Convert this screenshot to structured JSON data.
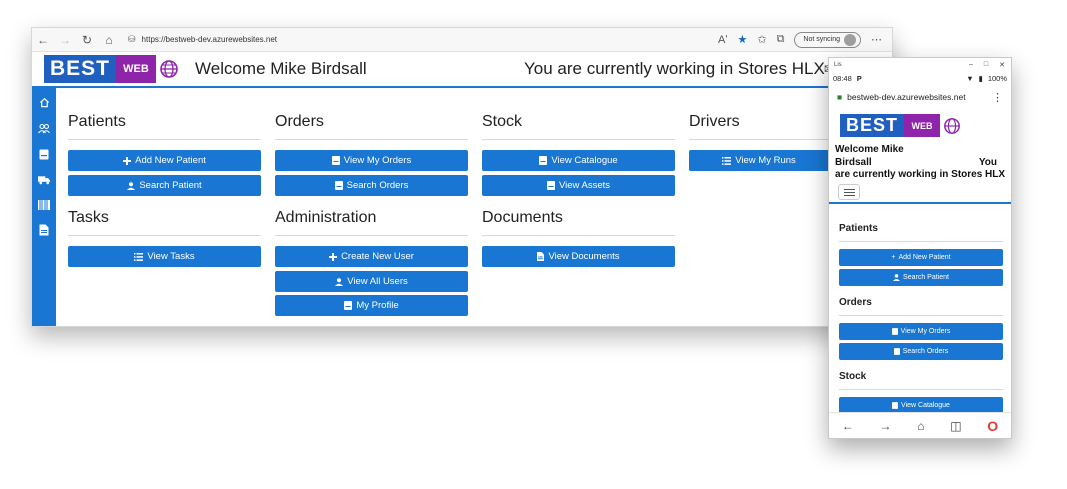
{
  "browser": {
    "url": "https://bestweb-dev.azurewebsites.net",
    "sync_label": "Not syncing",
    "read_aloud": "Aʹ"
  },
  "header": {
    "logo_best": "BEST",
    "logo_web": "WEB",
    "welcome": "Welcome Mike Birdsall",
    "working": "You are currently working in Stores HLX"
  },
  "sections": {
    "patients": {
      "title": "Patients",
      "add": "Add New Patient",
      "search": "Search Patient"
    },
    "orders": {
      "title": "Orders",
      "view": "View My Orders",
      "search": "Search Orders"
    },
    "stock": {
      "title": "Stock",
      "catalogue": "View Catalogue",
      "assets": "View Assets"
    },
    "drivers": {
      "title": "Drivers",
      "runs": "View My Runs"
    },
    "tasks": {
      "title": "Tasks",
      "view": "View Tasks"
    },
    "admin": {
      "title": "Administration",
      "create": "Create New User",
      "all": "View All Users",
      "profile": "My Profile"
    },
    "documents": {
      "title": "Documents",
      "view": "View Documents"
    }
  },
  "phone": {
    "title_app": "Lis",
    "time": "08:48",
    "carrier_mark": "P",
    "battery": "100%",
    "url": "bestweb-dev.azurewebsites.net",
    "welcome_line1": "Welcome Mike",
    "welcome_line2a": "Birdsall",
    "welcome_line2b": "You",
    "welcome_line3": "are currently working in Stores HLX"
  },
  "colors": {
    "primary": "#1976d2",
    "logo_blue": "#1f5fbf",
    "logo_purple": "#8e24aa"
  }
}
